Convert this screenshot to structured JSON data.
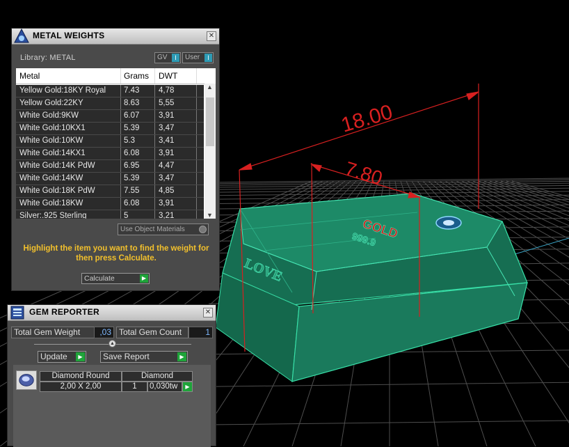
{
  "metal_weights": {
    "title": "METAL WEIGHTS",
    "library_label": "Library: METAL",
    "gv_label": "GV",
    "user_label": "User",
    "columns": [
      "Metal",
      "Grams",
      "DWT"
    ],
    "rows": [
      {
        "metal": "Yellow Gold:18KY Royal",
        "grams": "7.43",
        "dwt": "4,78"
      },
      {
        "metal": "Yellow Gold:22KY",
        "grams": "8.63",
        "dwt": "5,55"
      },
      {
        "metal": "White Gold:9KW",
        "grams": "6.07",
        "dwt": "3,91"
      },
      {
        "metal": "White Gold:10KX1",
        "grams": "5.39",
        "dwt": "3,47"
      },
      {
        "metal": "White Gold:10KW",
        "grams": "5.3",
        "dwt": "3,41"
      },
      {
        "metal": "White Gold:14KX1",
        "grams": "6.08",
        "dwt": "3,91"
      },
      {
        "metal": "White Gold:14K PdW",
        "grams": "6.95",
        "dwt": "4,47"
      },
      {
        "metal": "White Gold:14KW",
        "grams": "5.39",
        "dwt": "3,47"
      },
      {
        "metal": "White Gold:18K PdW",
        "grams": "7.55",
        "dwt": "4,85"
      },
      {
        "metal": "White Gold:18KW",
        "grams": "6.08",
        "dwt": "3,91"
      },
      {
        "metal": "Silver:.925 Sterling",
        "grams": "5",
        "dwt": "3,21"
      }
    ],
    "use_object_materials": "Use Object Materials",
    "hint": "Highlight the item you want to find the weight for then press Calculate.",
    "calculate_label": "Calculate"
  },
  "gem_reporter": {
    "title": "GEM REPORTER",
    "total_weight_label": "Total Gem Weight",
    "total_weight_value": ",03",
    "total_count_label": "Total Gem Count",
    "total_count_value": "1",
    "update_label": "Update",
    "save_report_label": "Save Report",
    "gem": {
      "shape": "Diamond Round",
      "material": "Diamond",
      "size": "2,00 X 2,00",
      "count": "1",
      "weight": "0,030tw"
    }
  },
  "viewport": {
    "dim_outer": "18.00",
    "dim_inner": "7.80",
    "engraving_top": "GOLD",
    "engraving_side": "LOVE",
    "engraving_small": "999.9",
    "accent_color": "#d82020",
    "model_color": "#1f8a68"
  }
}
